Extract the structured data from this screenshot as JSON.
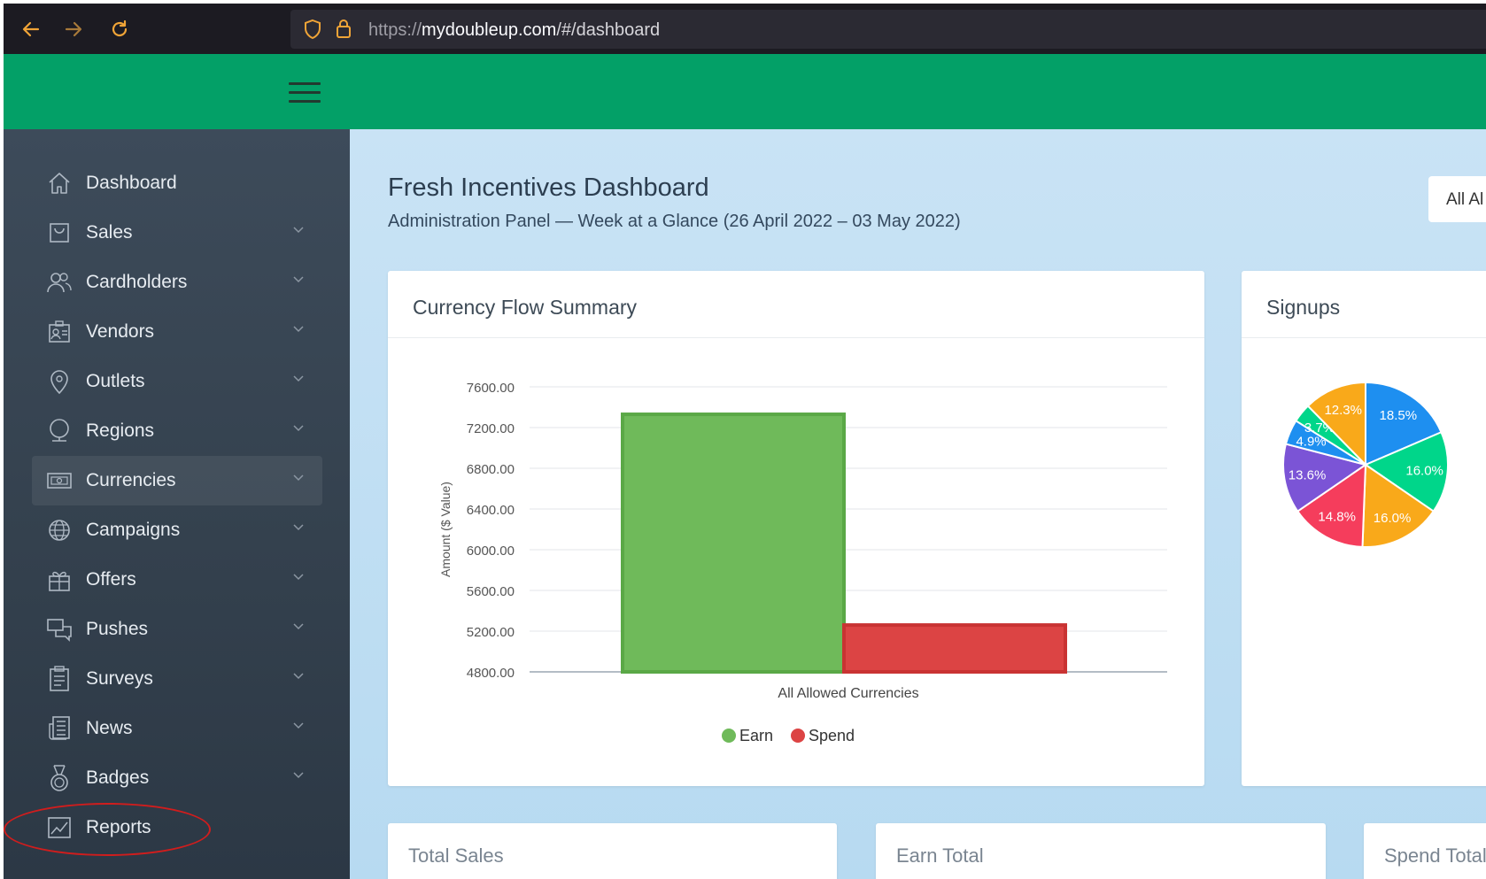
{
  "browser": {
    "url_scheme": "https://",
    "url_host": "mydoubleup.com",
    "url_path": "/#/dashboard"
  },
  "sidebar": {
    "items": [
      {
        "label": "Dashboard",
        "icon": "home-icon"
      },
      {
        "label": "Sales",
        "icon": "bag-icon"
      },
      {
        "label": "Cardholders",
        "icon": "users-icon"
      },
      {
        "label": "Vendors",
        "icon": "vendor-card-icon"
      },
      {
        "label": "Outlets",
        "icon": "map-pin-icon"
      },
      {
        "label": "Regions",
        "icon": "region-icon"
      },
      {
        "label": "Currencies",
        "icon": "money-icon"
      },
      {
        "label": "Campaigns",
        "icon": "globe-icon"
      },
      {
        "label": "Offers",
        "icon": "gift-icon"
      },
      {
        "label": "Pushes",
        "icon": "messages-icon"
      },
      {
        "label": "Surveys",
        "icon": "clipboard-icon"
      },
      {
        "label": "News",
        "icon": "newspaper-icon"
      },
      {
        "label": "Badges",
        "icon": "medal-icon"
      },
      {
        "label": "Reports",
        "icon": "chart-line-icon"
      }
    ],
    "active": "Currencies"
  },
  "header": {
    "title": "Fresh Incentives Dashboard",
    "subtitle": "Administration Panel — Week at a Glance (26 April 2022 – 03 May 2022)",
    "filter_label": "All Al"
  },
  "currency_card": {
    "title": "Currency Flow Summary"
  },
  "signups_card": {
    "title": "Signups"
  },
  "summary_cards": {
    "total_sales": "Total Sales",
    "earn_total": "Earn Total",
    "spend_total": "Spend Total"
  },
  "colors": {
    "brand_green": "#03a067",
    "earn": "#6fba5a",
    "spend": "#dc4444",
    "annotation_ring": "#d01d1d"
  },
  "chart_data": [
    {
      "type": "bar",
      "title": "",
      "categories": [
        "All Allowed Currencies"
      ],
      "series": [
        {
          "name": "Earn",
          "values": [
            7330
          ],
          "color": "#6fba5a"
        },
        {
          "name": "Spend",
          "values": [
            5260
          ],
          "color": "#dc4444"
        }
      ],
      "xlabel": "All Allowed Currencies",
      "ylabel": "Amount ($ Value)",
      "yticks": [
        "7600.00",
        "7200.00",
        "6800.00",
        "6400.00",
        "6000.00",
        "5600.00",
        "5200.00",
        "4800.00"
      ],
      "ylim": [
        4800,
        7600
      ],
      "legend": "bottom"
    },
    {
      "type": "pie",
      "title": "",
      "slices": [
        {
          "label": "18.5%",
          "value": 18.5,
          "color": "#1e8ff0"
        },
        {
          "label": "16.0%",
          "value": 16.0,
          "color": "#00d68a"
        },
        {
          "label": "16.0%",
          "value": 16.0,
          "color": "#f9a91a"
        },
        {
          "label": "14.8%",
          "value": 14.8,
          "color": "#f53d5c"
        },
        {
          "label": "13.6%",
          "value": 13.6,
          "color": "#7b54d6"
        },
        {
          "label": "4.9%",
          "value": 4.9,
          "color": "#1e8ff0"
        },
        {
          "label": "3.7%",
          "value": 3.7,
          "color": "#00d68a"
        },
        {
          "label": "12.3%",
          "value": 12.3,
          "color": "#f9a91a"
        }
      ]
    }
  ]
}
